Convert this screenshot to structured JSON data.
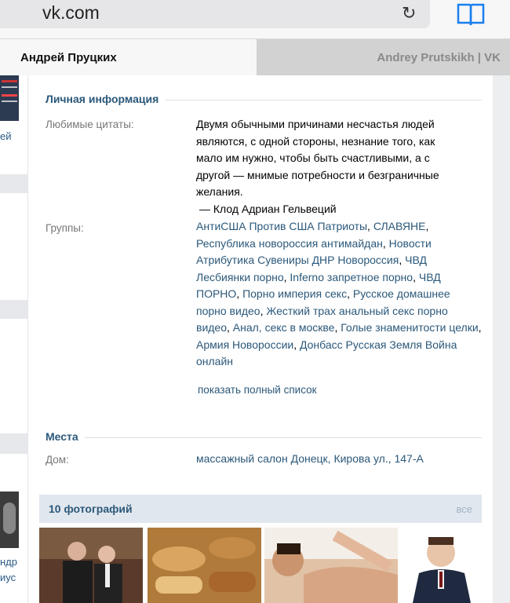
{
  "browser": {
    "url": "vk.com",
    "reload_icon": "reload-icon",
    "bookmarks_icon": "book-icon"
  },
  "tabs": [
    {
      "label": "Андрей Пруцких",
      "active": true
    },
    {
      "label": "Andrey Prutskikh | VK",
      "active": false
    }
  ],
  "sidebar_fragments": {
    "text1": "ей",
    "text2": "ндр",
    "text3": "иус"
  },
  "personal": {
    "header": "Личная информация",
    "quote_label": "Любимые цитаты:",
    "quote_lines": [
      "Двумя обычными причинами несчастья людей",
      "являются, с одной стороны, незнание того, как",
      "мало им нужно, чтобы быть счастливыми, а с",
      "другой — мнимые потребности и безграничные",
      "желания.",
      "— Клод Адриан Гельвеций"
    ],
    "groups_label": "Группы:",
    "groups": [
      "АнтиСША Против США Патриоты",
      "СЛАВЯНЕ",
      "Республика новороссия антимайдан",
      "Новости Атрибутика Сувениры ДНР Новороссия",
      "ЧВД Лесбиянки порно",
      "Inferno запретное порно",
      "ЧВД ПОРНО",
      "Порно империя секс",
      "Русское домашнее порно видео",
      "Жесткий трах анальный секс порно видео",
      "Анал, секс в москве",
      "Голые знаменитости целки",
      "Армия Новороссии",
      "Донбасс Русская Земля Война онлайн"
    ],
    "show_all": "показать полный список"
  },
  "places": {
    "header": "Места",
    "home_label": "Дом:",
    "home_value": "массажный салон Донецк, Кирова ул., 147-А"
  },
  "photos": {
    "title": "10 фотографий",
    "all_link": "все"
  },
  "colors": {
    "link": "#2b587a",
    "header_bg": "#e1e7ee",
    "page_bg": "#edeef0"
  }
}
